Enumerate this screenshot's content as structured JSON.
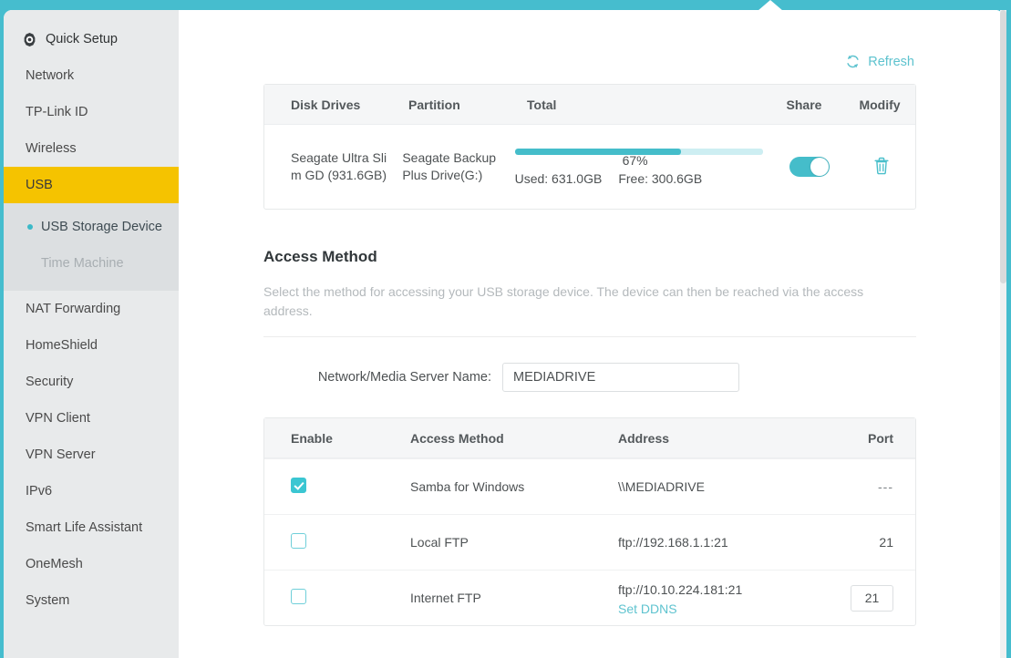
{
  "sidebar": {
    "items": [
      {
        "label": "Quick Setup",
        "icon": "gear-icon",
        "active": false
      },
      {
        "label": "Network",
        "active": false
      },
      {
        "label": "TP-Link ID",
        "active": false
      },
      {
        "label": "Wireless",
        "active": false
      },
      {
        "label": "USB",
        "active": true
      }
    ],
    "submenu": [
      {
        "label": "USB Storage Device",
        "selected": true
      },
      {
        "label": "Time Machine",
        "selected": false
      }
    ],
    "items_after": [
      {
        "label": "NAT Forwarding"
      },
      {
        "label": "HomeShield"
      },
      {
        "label": "Security"
      },
      {
        "label": "VPN Client"
      },
      {
        "label": "VPN Server"
      },
      {
        "label": "IPv6"
      },
      {
        "label": "Smart Life Assistant"
      },
      {
        "label": "OneMesh"
      },
      {
        "label": "System"
      }
    ]
  },
  "toolbar": {
    "refresh_label": "Refresh"
  },
  "disk_table": {
    "headers": {
      "disk": "Disk Drives",
      "partition": "Partition",
      "total": "Total",
      "share": "Share",
      "modify": "Modify"
    },
    "rows": [
      {
        "disk_line1": "Seagate  Ultra Sli",
        "disk_line2": "m GD (931.6GB)",
        "partition_line1": "Seagate Backup",
        "partition_line2": "Plus Drive(G:)",
        "percent_label": "67%",
        "percent_value": 67,
        "used": "Used: 631.0GB",
        "free": "Free: 300.6GB",
        "share_enabled": true
      }
    ]
  },
  "access_method": {
    "title": "Access Method",
    "description": "Select the method for accessing your USB storage device. The device can then be reached via the access address.",
    "server_name_label": "Network/Media Server Name:",
    "server_name_value": "MEDIADRIVE",
    "headers": {
      "enable": "Enable",
      "method": "Access Method",
      "address": "Address",
      "port": "Port"
    },
    "rows": [
      {
        "enabled": true,
        "method": "Samba for Windows",
        "address": "\\\\MEDIADRIVE",
        "port": "---",
        "port_editable": false,
        "link": null
      },
      {
        "enabled": false,
        "method": "Local FTP",
        "address": "ftp://192.168.1.1:21",
        "port": "21",
        "port_editable": false,
        "link": null
      },
      {
        "enabled": false,
        "method": "Internet FTP",
        "address": "ftp://10.10.224.181:21",
        "port": "21",
        "port_editable": true,
        "link": "Set DDNS"
      }
    ]
  },
  "colors": {
    "brand_teal": "#46bdce",
    "accent_teal": "#45bdca",
    "highlight_yellow": "#f5c300",
    "sidebar_bg": "#e8eaeb",
    "submenu_bg": "#dcdfe1"
  }
}
